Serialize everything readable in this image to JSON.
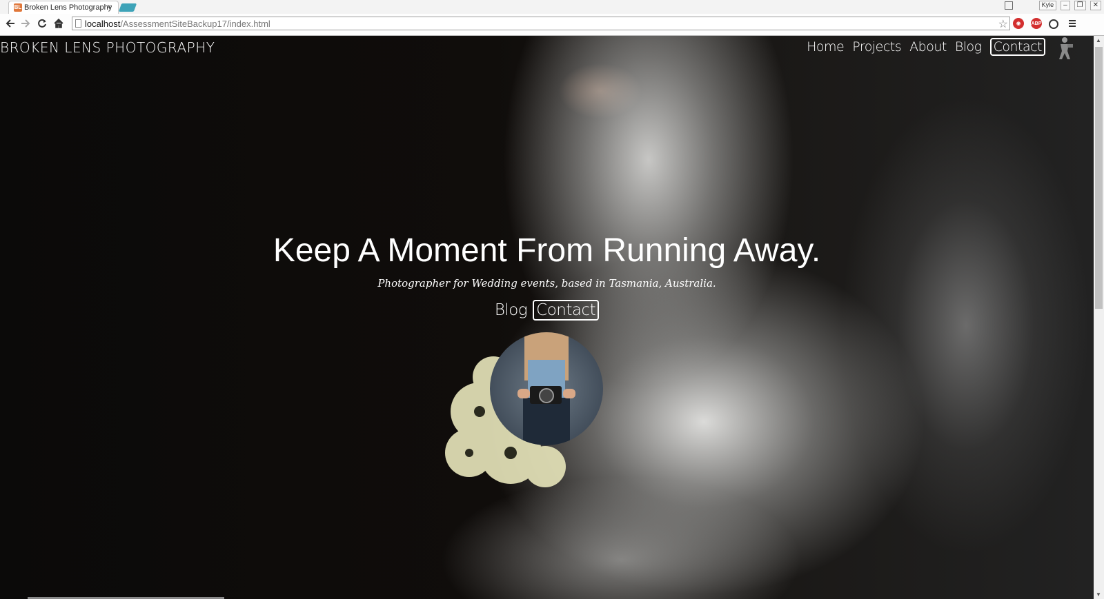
{
  "browser": {
    "tab_title": "Broken Lens Photography",
    "tab_favicon": "BL",
    "tab_close": "×",
    "user_label": "Kyle",
    "url_host": "localhost",
    "url_path": "/AssessmentSiteBackup17/index.html",
    "extension_abp": "ABP"
  },
  "site": {
    "brand": "BROKEN LENS PHOTOGRAPHY",
    "nav": [
      "Home",
      "Projects",
      "About",
      "Blog",
      "Contact"
    ]
  },
  "hero": {
    "title": "Keep A Moment From Running Away.",
    "subtitle": "Photographer for Wedding events, based in Tasmania, Australia.",
    "links": [
      "Blog",
      "Contact"
    ]
  },
  "colors": {
    "accent_tab": "#3ea3b8",
    "favicon": "#e0773a",
    "ext_red": "#d32f2f"
  }
}
